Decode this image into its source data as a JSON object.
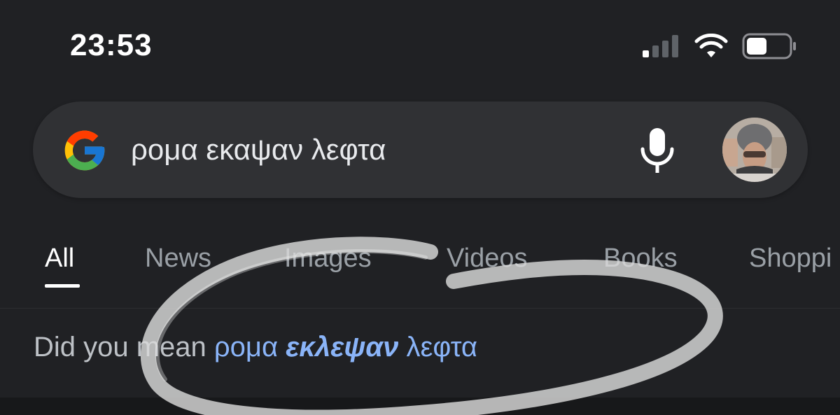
{
  "status_bar": {
    "time": "23:53",
    "icons": [
      "signal-icon",
      "wifi-icon",
      "battery-icon"
    ],
    "battery_level": 0.5
  },
  "search": {
    "query": "ρομα εκαψαν λεφτα",
    "logo": "google-logo",
    "mic_icon": "mic-icon",
    "avatar": "avatar"
  },
  "tabs": [
    {
      "label": "All",
      "active": true
    },
    {
      "label": "News",
      "active": false
    },
    {
      "label": "Images",
      "active": false
    },
    {
      "label": "Videos",
      "active": false
    },
    {
      "label": "Books",
      "active": false
    },
    {
      "label": "Shoppi",
      "active": false
    }
  ],
  "did_you_mean": {
    "prefix": "Did you mean",
    "suggestion_start": "ρομα",
    "suggestion_bold": "εκλεψαν",
    "suggestion_end": "λεφτα"
  },
  "colors": {
    "background": "#202124",
    "search_bar": "#303134",
    "link": "#8ab4f8",
    "inactive_tab": "#9aa0a6",
    "annotation": "#d9d9d9"
  }
}
